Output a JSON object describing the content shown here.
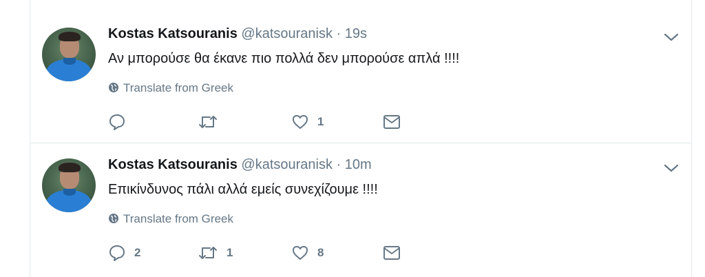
{
  "tweets": [
    {
      "name": "Kostas Katsouranis",
      "handle": "@katsouranisk",
      "separator": "·",
      "time": "19s",
      "text": "Αν μπορούσε θα έκανε πιο πολλά δεν μπορούσε απλά !!!!",
      "translate": "Translate from Greek",
      "reply_count": "",
      "retweet_count": "",
      "like_count": "1"
    },
    {
      "name": "Kostas Katsouranis",
      "handle": "@katsouranisk",
      "separator": "·",
      "time": "10m",
      "text": "Επικίνδυνος πάλι αλλά εμείς συνεχίζουμε !!!!",
      "translate": "Translate from Greek",
      "reply_count": "2",
      "retweet_count": "1",
      "like_count": "8"
    }
  ],
  "icons": {
    "reply": "reply-icon",
    "retweet": "retweet-icon",
    "like": "heart-icon",
    "dm": "envelope-icon",
    "menu": "chevron-down-icon",
    "globe": "globe-icon"
  },
  "colors": {
    "text": "#14171a",
    "muted": "#657786",
    "border": "#e6ecf0"
  }
}
